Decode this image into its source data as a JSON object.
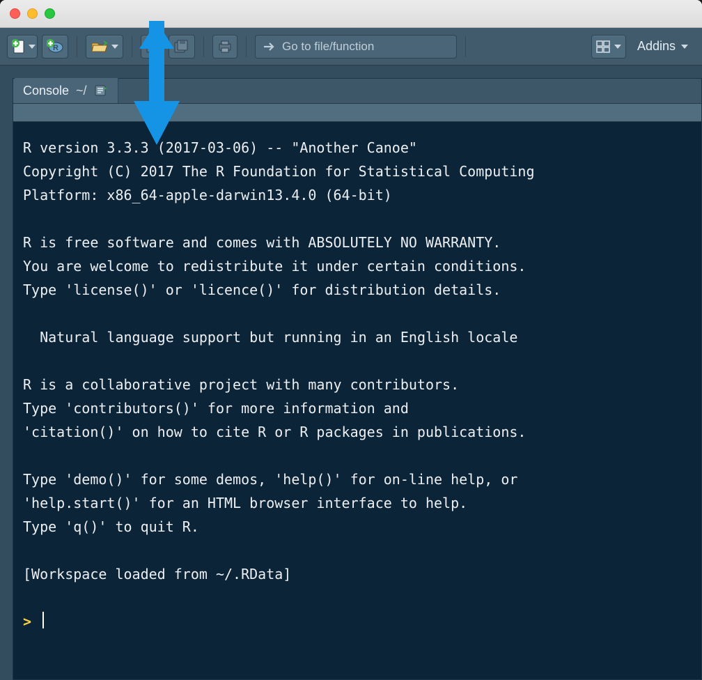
{
  "toolbar": {
    "goto_placeholder": "Go to file/function",
    "addins_label": "Addins"
  },
  "console": {
    "tab_label": "Console",
    "tab_path": "~/",
    "lines": [
      "R version 3.3.3 (2017-03-06) -- \"Another Canoe\"",
      "Copyright (C) 2017 The R Foundation for Statistical Computing",
      "Platform: x86_64-apple-darwin13.4.0 (64-bit)",
      "",
      "R is free software and comes with ABSOLUTELY NO WARRANTY.",
      "You are welcome to redistribute it under certain conditions.",
      "Type 'license()' or 'licence()' for distribution details.",
      "",
      "  Natural language support but running in an English locale",
      "",
      "R is a collaborative project with many contributors.",
      "Type 'contributors()' for more information and",
      "'citation()' on how to cite R or R packages in publications.",
      "",
      "Type 'demo()' for some demos, 'help()' for on-line help, or",
      "'help.start()' for an HTML browser interface to help.",
      "Type 'q()' to quit R.",
      "",
      "[Workspace loaded from ~/.RData]",
      ""
    ],
    "prompt": ">"
  }
}
